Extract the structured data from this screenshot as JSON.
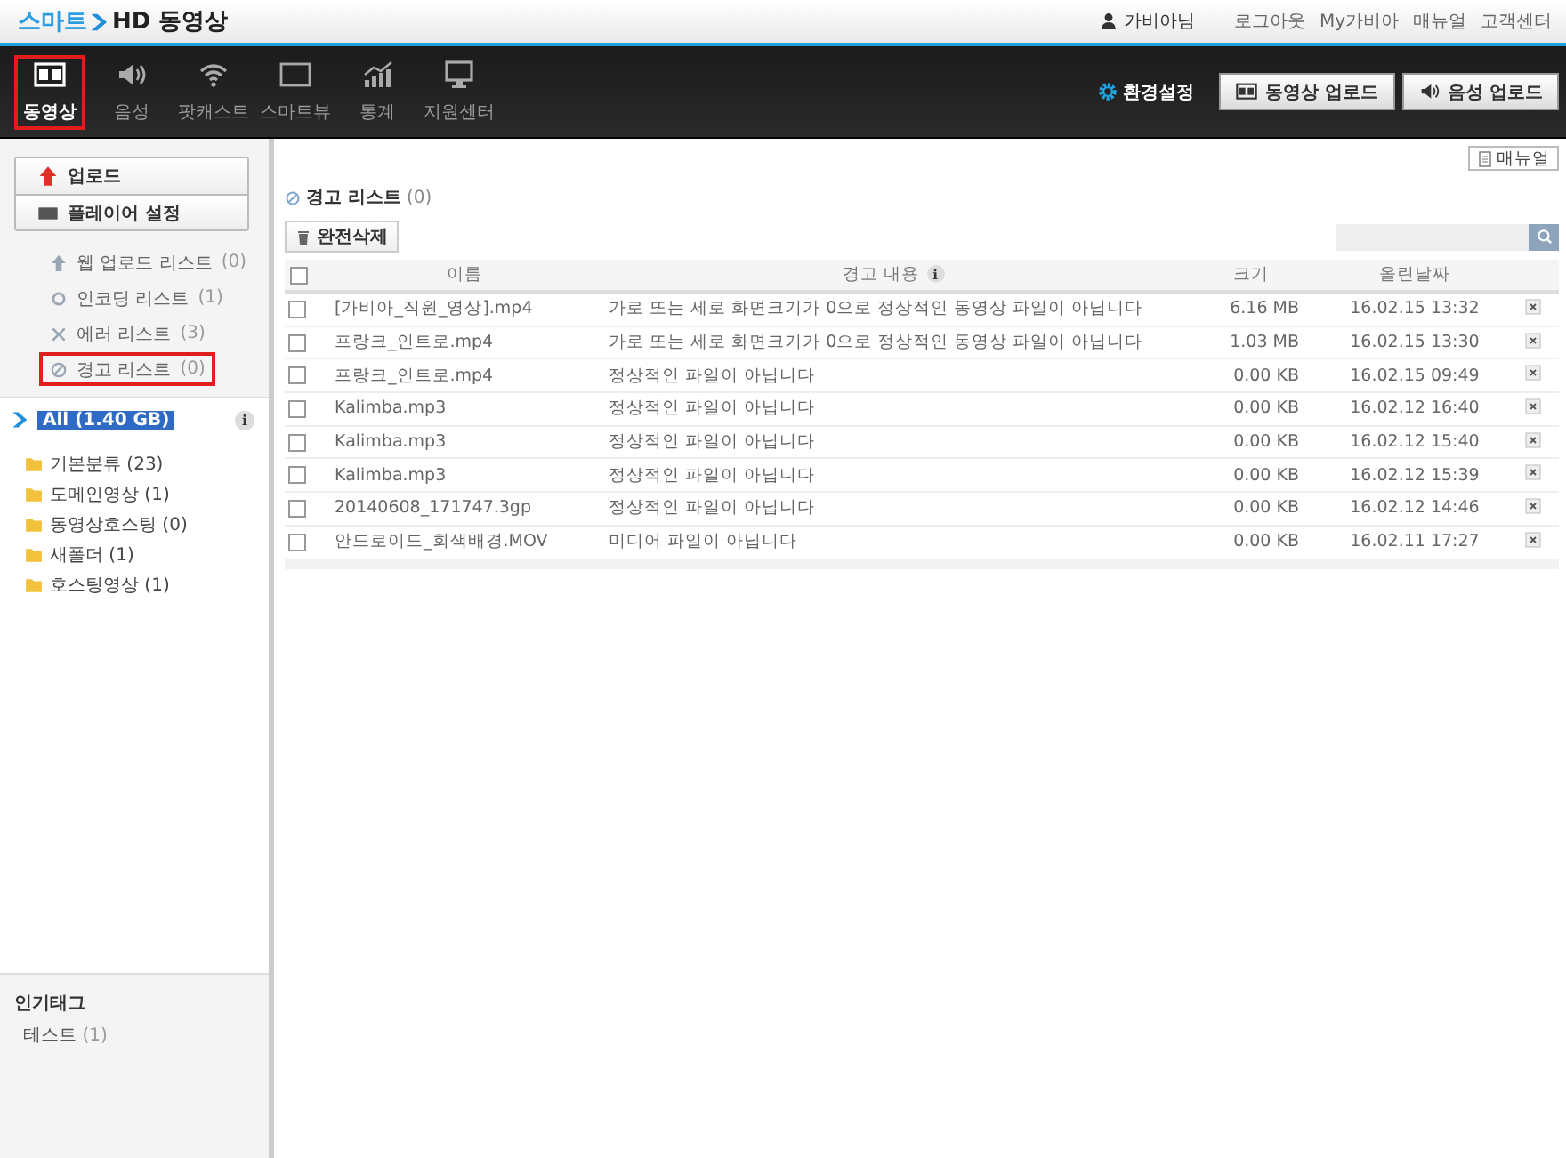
{
  "header": {
    "logo_prefix": "스마트",
    "logo_suffix": "HD 동영상",
    "user": "가비아님",
    "links": [
      "로그아웃",
      "My가비아",
      "매뉴얼",
      "고객센터"
    ]
  },
  "nav": {
    "items": [
      {
        "label": "동영상",
        "kind": "film",
        "selected": true
      },
      {
        "label": "음성",
        "kind": "speaker",
        "selected": false
      },
      {
        "label": "팟캐스트",
        "kind": "wifi",
        "selected": false
      },
      {
        "label": "스마트뷰",
        "kind": "screen",
        "selected": false
      },
      {
        "label": "통계",
        "kind": "chart",
        "selected": false
      },
      {
        "label": "지원센터",
        "kind": "monitor",
        "selected": false
      }
    ],
    "settings": "환경설정",
    "buttons": [
      {
        "label": "동영상 업로드",
        "kind": "film"
      },
      {
        "label": "음성 업로드",
        "kind": "speaker"
      }
    ]
  },
  "sidebar": {
    "actions": [
      {
        "label": "업로드",
        "kind": "up"
      },
      {
        "label": "플레이어 설정",
        "kind": "bar"
      }
    ],
    "lists": [
      {
        "label": "웹 업로드 리스트",
        "count": "(0)",
        "kind": "up",
        "selected": false
      },
      {
        "label": "인코딩 리스트",
        "count": "(1)",
        "kind": "ring",
        "selected": false
      },
      {
        "label": "에러 리스트",
        "count": "(3)",
        "kind": "x",
        "selected": false
      },
      {
        "label": "경고 리스트",
        "count": "(0)",
        "kind": "ban",
        "selected": true
      }
    ],
    "root": "All (1.40 GB)",
    "info": "i",
    "folders": [
      {
        "label": "기본분류",
        "count": "(23)"
      },
      {
        "label": "도메인영상",
        "count": "(1)"
      },
      {
        "label": "동영상호스팅",
        "count": "(0)"
      },
      {
        "label": "새폴더",
        "count": "(1)"
      },
      {
        "label": "호스팅영상",
        "count": "(1)"
      }
    ],
    "tags_title": "인기태그",
    "tags": [
      {
        "label": "테스트",
        "count": "(1)"
      }
    ]
  },
  "main": {
    "manual": "매뉴얼",
    "title": "경고 리스트",
    "count": "(0)",
    "delete": "완전삭제",
    "columns": [
      "이름",
      "경고 내용",
      "크기",
      "올린날짜"
    ],
    "info": "i",
    "select_all_checked": false,
    "rows": [
      {
        "name": "[가비아_직원_영상].mp4",
        "warning": "가로 또는 세로 화면크기가 0으로 정상적인 동영상 파일이 아닙니다",
        "size": "6.16 MB",
        "date": "16.02.15 13:32",
        "checked": false
      },
      {
        "name": "프랑크_인트로.mp4",
        "warning": "가로 또는 세로 화면크기가 0으로 정상적인 동영상 파일이 아닙니다",
        "size": "1.03 MB",
        "date": "16.02.15 13:30",
        "checked": false
      },
      {
        "name": "프랑크_인트로.mp4",
        "warning": "정상적인 파일이 아닙니다",
        "size": "0.00 KB",
        "date": "16.02.15 09:49",
        "checked": false
      },
      {
        "name": "Kalimba.mp3",
        "warning": "정상적인 파일이 아닙니다",
        "size": "0.00 KB",
        "date": "16.02.12 16:40",
        "checked": false
      },
      {
        "name": "Kalimba.mp3",
        "warning": "정상적인 파일이 아닙니다",
        "size": "0.00 KB",
        "date": "16.02.12 15:40",
        "checked": false
      },
      {
        "name": "Kalimba.mp3",
        "warning": "정상적인 파일이 아닙니다",
        "size": "0.00 KB",
        "date": "16.02.12 15:39",
        "checked": false
      },
      {
        "name": "20140608_171747.3gp",
        "warning": "정상적인 파일이 아닙니다",
        "size": "0.00 KB",
        "date": "16.02.12 14:46",
        "checked": false
      },
      {
        "name": "안드로이드_회색배경.MOV",
        "warning": "미디어 파일이 아닙니다",
        "size": "0.00 KB",
        "date": "16.02.11 17:27",
        "checked": false
      }
    ]
  }
}
